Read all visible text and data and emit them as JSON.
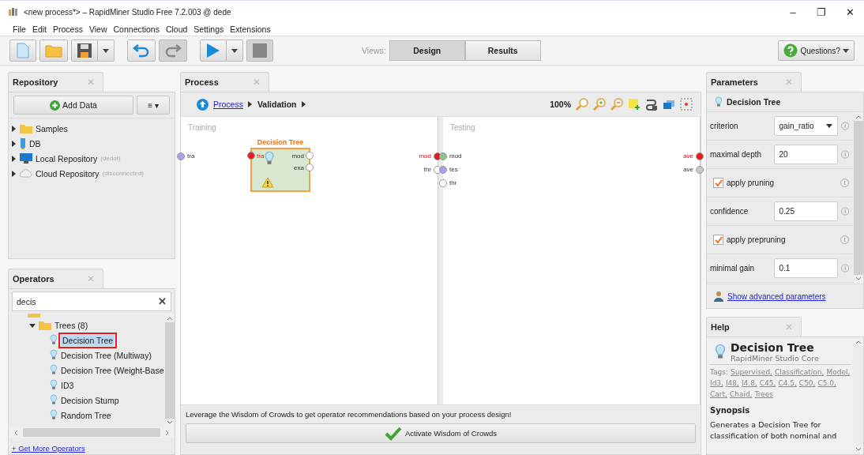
{
  "window": {
    "title": "<new process*> – RapidMiner Studio Free 7.2.003 @ dede",
    "controls": [
      "–",
      "❐",
      "✕"
    ]
  },
  "menu": [
    "File",
    "Edit",
    "Process",
    "View",
    "Connections",
    "Cloud",
    "Settings",
    "Extensions"
  ],
  "toolbar": {
    "views_label": "Views:",
    "views": [
      {
        "label": "Design",
        "selected": true
      },
      {
        "label": "Results",
        "selected": false
      }
    ],
    "help_button": "Questions?"
  },
  "repository": {
    "tab": "Repository",
    "close": "✕",
    "add_button": "Add Data",
    "menu_button": "≡ ▾",
    "items": [
      {
        "kind": "folder",
        "label": "Samples"
      },
      {
        "kind": "database",
        "label": "DB"
      },
      {
        "kind": "monitor",
        "label": "Local Repository",
        "note": "(dedot)"
      },
      {
        "kind": "cloud",
        "label": "Cloud Repository",
        "note": "(disconnected)"
      }
    ]
  },
  "operators": {
    "tab": "Operators",
    "close": "✕",
    "search": "decis",
    "clear": "✕",
    "tree": [
      {
        "label": "Trees (8)",
        "expanded": true,
        "children": [
          {
            "label": "Decision Tree",
            "selected": true
          },
          {
            "label": "Decision Tree (Multiway)",
            "selected": false
          },
          {
            "label": "Decision Tree (Weight-Base",
            "selected": false
          },
          {
            "label": "ID3",
            "selected": false
          },
          {
            "label": "Decision Stump",
            "selected": false
          },
          {
            "label": "Random Tree",
            "selected": false
          }
        ]
      }
    ],
    "link": "+ Get More Operators"
  },
  "process": {
    "tab": "Process",
    "close": "✕",
    "breadcrumb": [
      {
        "label": "Process",
        "link": true
      },
      {
        "label": "Validation",
        "link": false
      }
    ],
    "zoom": "100%",
    "subprocesses": [
      {
        "title": "Training",
        "inputs": [
          {
            "label": "tra",
            "color": "#a9a0e8",
            "required": false
          }
        ],
        "outputs": [
          {
            "label": "mod",
            "color": "#e02020",
            "required": true
          },
          {
            "label": "thr",
            "color": "#ffffff",
            "required": false
          }
        ]
      },
      {
        "title": "Testing",
        "inputs": [
          {
            "label": "mod",
            "color": "#8fc48f",
            "required": false
          },
          {
            "label": "tes",
            "color": "#a9a0e8",
            "required": false
          },
          {
            "label": "thr",
            "color": "#ffffff",
            "required": false
          }
        ],
        "outputs": [
          {
            "label": "ave",
            "color": "#e02020",
            "required": true
          },
          {
            "label": "ave",
            "color": "#c8c8c8",
            "required": false
          }
        ]
      }
    ],
    "operator": {
      "name": "Decision Tree",
      "warning": true,
      "inputs": [
        {
          "label": "tra",
          "color": "#e02020",
          "required": true
        }
      ],
      "outputs": [
        {
          "label": "mod",
          "color": "#ffffff",
          "required": false
        },
        {
          "label": "exa",
          "color": "#ffffff",
          "required": false
        }
      ]
    },
    "wisdom_text": "Leverage the Wisdom of Crowds to get operator recommendations based on your process design!",
    "wisdom_button": "Activate Wisdom of Crowds"
  },
  "parameters": {
    "tab": "Parameters",
    "close": "✕",
    "operator": "Decision Tree",
    "rows": [
      {
        "kind": "select",
        "label": "criterion",
        "value": "gain_ratio"
      },
      {
        "kind": "input",
        "label": "maximal depth",
        "value": "20"
      },
      {
        "kind": "checkbox",
        "label": "apply pruning",
        "checked": true
      },
      {
        "kind": "input",
        "label": "confidence",
        "value": "0.25"
      },
      {
        "kind": "checkbox",
        "label": "apply prepruning",
        "checked": true
      },
      {
        "kind": "input",
        "label": "minimal gain",
        "value": "0.1"
      }
    ],
    "advanced_link": "Show advanced parameters"
  },
  "help": {
    "tab": "Help",
    "close": "✕",
    "title": "Decision Tree",
    "subtitle": "RapidMiner Studio Core",
    "tags_label": "Tags:",
    "tags": [
      "Supervised,",
      "Classification,",
      "Model,",
      "Id3,",
      "J48,",
      "J4.8,",
      "C45,",
      "C4.5,",
      "C50,",
      "C5.0,",
      "Cart,",
      "Chaid,",
      "Trees"
    ],
    "synopsis_title": "Synopsis",
    "synopsis": "Generates a Decision Tree for classification of both nominal and"
  }
}
